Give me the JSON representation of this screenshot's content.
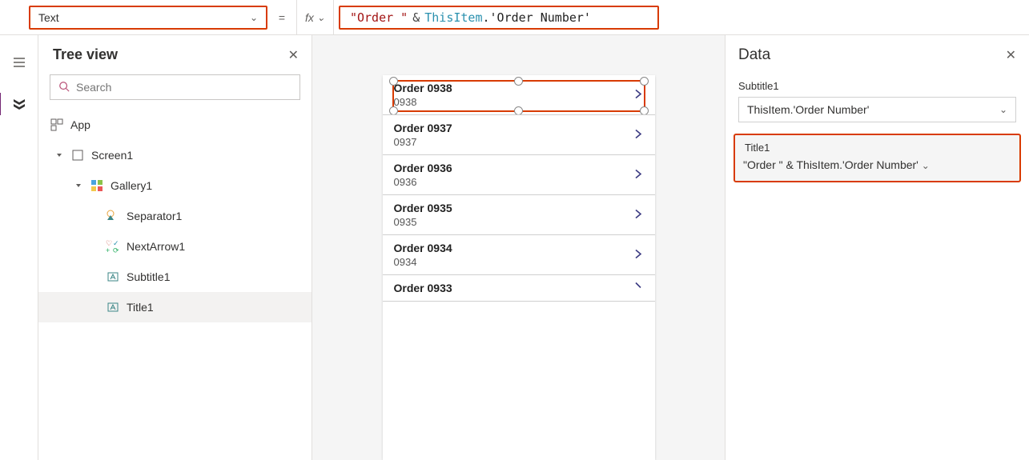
{
  "topbar": {
    "property_name": "Text",
    "equals": "=",
    "fx": "fx",
    "formula_parts": {
      "str": "\"Order \"",
      "amp": "&",
      "obj": "ThisItem",
      "dot": ".",
      "prop": "'Order Number'"
    }
  },
  "tree": {
    "title": "Tree view",
    "search_placeholder": "Search",
    "nodes": {
      "app": "App",
      "screen1": "Screen1",
      "gallery1": "Gallery1",
      "separator1": "Separator1",
      "nextarrow1": "NextArrow1",
      "subtitle1": "Subtitle1",
      "title1": "Title1"
    }
  },
  "gallery": [
    {
      "title": "Order 0938",
      "sub": "0938"
    },
    {
      "title": "Order 0937",
      "sub": "0937"
    },
    {
      "title": "Order 0936",
      "sub": "0936"
    },
    {
      "title": "Order 0935",
      "sub": "0935"
    },
    {
      "title": "Order 0934",
      "sub": "0934"
    },
    {
      "title": "Order 0933",
      "sub": ""
    }
  ],
  "data_pane": {
    "heading": "Data",
    "subtitle_label": "Subtitle1",
    "subtitle_value": "ThisItem.'Order Number'",
    "title_label": "Title1",
    "title_value": "\"Order \" & ThisItem.'Order Number'"
  }
}
